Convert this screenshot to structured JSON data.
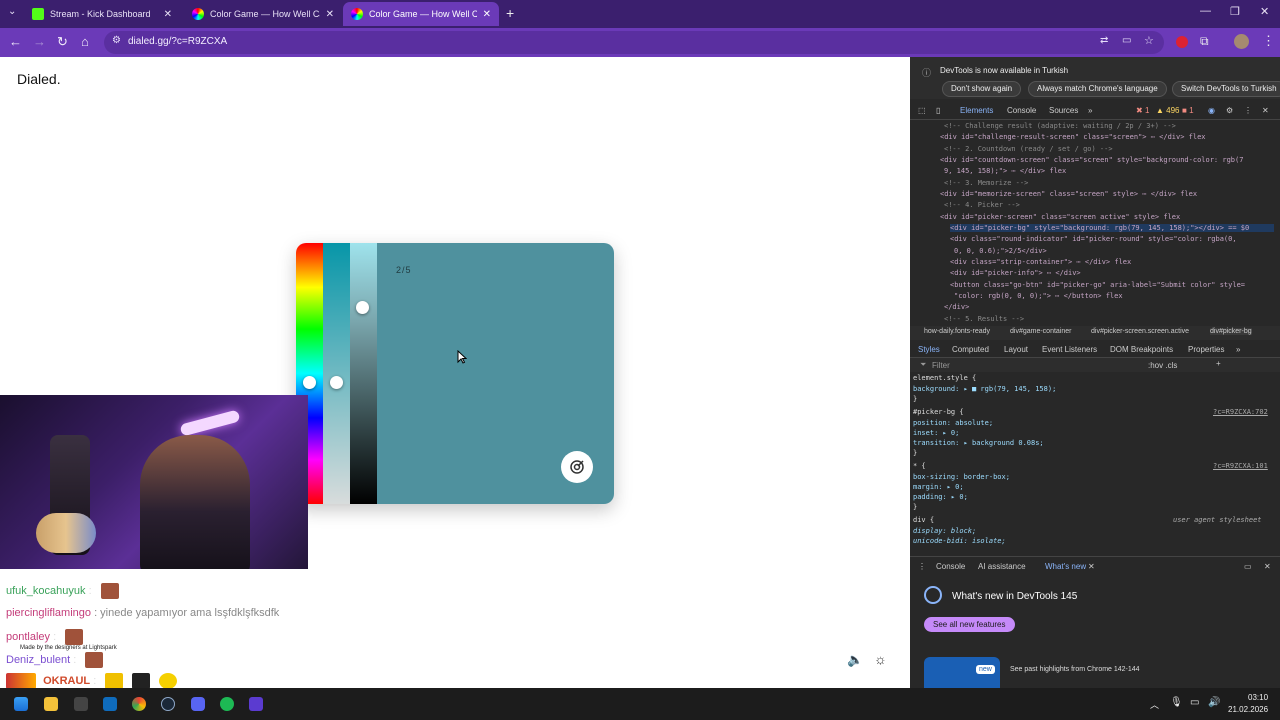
{
  "browser": {
    "tabs": [
      {
        "title": "Stream - Kick Dashboard",
        "icon": "kick-icon",
        "color": "#53fc18"
      },
      {
        "title": "Color Game — How Well Can Y",
        "icon": "color-wheel-icon",
        "color": "#e04fa0"
      },
      {
        "title": "Color Game — How Well Can Y",
        "icon": "color-wheel-icon",
        "color": "#e04fa0"
      }
    ],
    "new_tab": "+",
    "url": "dialed.gg/?c=R9ZCXA"
  },
  "page": {
    "logo": "Dialed.",
    "round": "2/5",
    "picker_color": "#4f919e",
    "made_by": "Made by the designers at Lightspark"
  },
  "chat": [
    {
      "user": "ufuk_kocahuyuk",
      "text": ":",
      "color": "#3aa25a"
    },
    {
      "user": "piercingliflamingo",
      "text": ": yinede yapamıyor ama lsşfdklşfksdfk",
      "color": "#c43d7a"
    },
    {
      "user": "pontlaley",
      "text": ":",
      "color": "#c43d7a"
    },
    {
      "user": "Deniz_bulent",
      "text": ":",
      "color": "#7b4fd1"
    },
    {
      "user": "OKRAUL",
      "text": ":",
      "color": "#d04a2b"
    }
  ],
  "devtools": {
    "info": "DevTools is now available in Turkish",
    "btn_dont_show": "Don't show again",
    "btn_match": "Always match Chrome's language",
    "btn_switch": "Switch DevTools to Turkish",
    "tabs": [
      "Elements",
      "Console",
      "Sources"
    ],
    "errors": "1",
    "warnings": "496",
    "issues": "1",
    "elements": [
      "<!-- Challenge result (adaptive: waiting / 2p / 3+) -->",
      "<div id=\"challenge-result-screen\" class=\"screen\"> ⋯ </div>  flex",
      "<!-- 2. Countdown (ready / set / go) -->",
      "<div id=\"countdown-screen\" class=\"screen\" style=\"background-color: rgb(7",
      "9, 145, 158);\"> ⋯ </div>  flex",
      "<!-- 3. Memorize -->",
      "<div id=\"memorize-screen\" class=\"screen\" style> ⋯ </div>  flex",
      "<!-- 4. Picker -->",
      "<div id=\"picker-screen\" class=\"screen active\" style>  flex",
      "<div id=\"picker-bg\" style=\"background: rgb(79, 145, 158);\"></div> == $0",
      "<div class=\"round-indicator\" id=\"picker-round\" style=\"color: rgba(0,",
      "0, 0, 0.6);\">2/5</div>",
      "<div class=\"strip-container\"> ⋯ </div>  flex",
      "<div id=\"picker-info\"> ⋯ </div>",
      "<button class=\"go-btn\" id=\"picker-go\" aria-label=\"Submit color\" style=",
      "\"color: rgb(0, 0, 0);\"> ⋯ </button>  flex",
      "</div>",
      "<!-- 5. Results -->"
    ],
    "crumbs": [
      "how-daily.fonts-ready",
      "div#game-container",
      "div#picker-screen.screen.active",
      "div#picker-bg"
    ],
    "subtabs": [
      "Styles",
      "Computed",
      "Layout",
      "Event Listeners",
      "DOM Breakpoints",
      "Properties"
    ],
    "filter": "Filter",
    "filter_right": ":hov .cls",
    "styles": [
      {
        "text": "element.style {",
        "src": ""
      },
      {
        "text": "  background: ▸ ■ rgb(79, 145, 158);",
        "src": ""
      },
      {
        "text": "}",
        "src": ""
      },
      {
        "text": "#picker-bg {",
        "src": "?c=R9ZCXA:702"
      },
      {
        "text": "  position: absolute;",
        "src": ""
      },
      {
        "text": "  inset: ▸ 0;",
        "src": ""
      },
      {
        "text": "  transition: ▸ background 0.08s;",
        "src": ""
      },
      {
        "text": "}",
        "src": ""
      },
      {
        "text": "* {",
        "src": "?c=R9ZCXA:101"
      },
      {
        "text": "  box-sizing: border-box;",
        "src": ""
      },
      {
        "text": "  margin: ▸ 0;",
        "src": ""
      },
      {
        "text": "  padding: ▸ 0;",
        "src": ""
      },
      {
        "text": "}",
        "src": ""
      },
      {
        "text": "div {",
        "src": "user agent stylesheet"
      },
      {
        "text": "  display: block;",
        "src": ""
      },
      {
        "text": "  unicode-bidi: isolate;",
        "src": ""
      },
      {
        "text": "}",
        "src": ""
      }
    ],
    "drawer_tabs": [
      "Console",
      "AI assistance",
      "What's new"
    ],
    "whats_new": "What's new in DevTools 145",
    "see_all": "See all new features",
    "new_badge": "new",
    "highlights": "See past highlights from Chrome 142-144"
  },
  "taskbar": {
    "time": "03:10",
    "date": "21.02.2026"
  }
}
